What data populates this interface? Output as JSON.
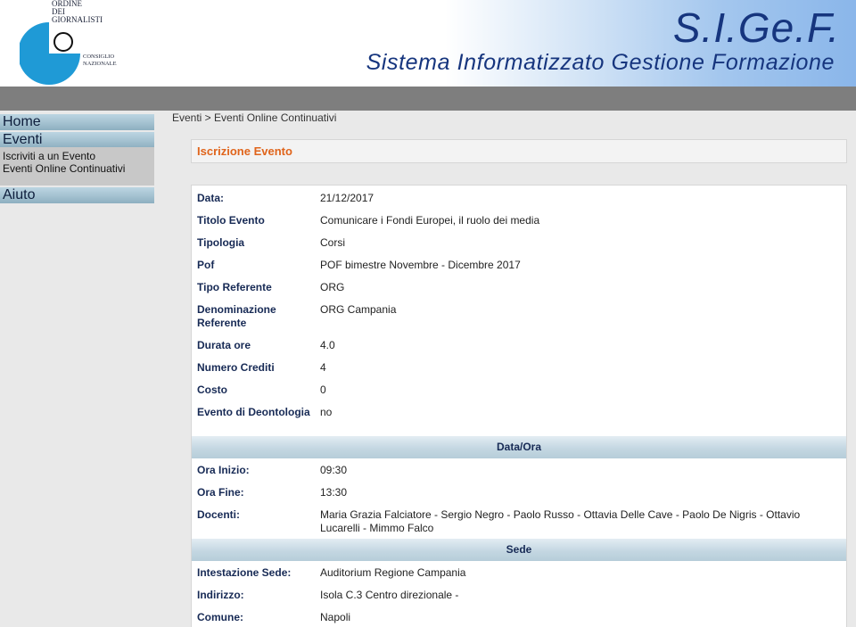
{
  "header": {
    "logo_top_lines": [
      "ORDINE",
      "DEI",
      "GIORNALISTI"
    ],
    "logo_bottom_lines": [
      "CONSIGLIO",
      "NAZIONALE"
    ],
    "title": "S.I.Ge.F.",
    "subtitle": "Sistema Informatizzato Gestione Formazione"
  },
  "sidebar": {
    "home": "Home",
    "eventi": "Eventi",
    "sub_items": [
      "Iscriviti a un Evento",
      "Eventi Online Continuativi"
    ],
    "aiuto": "Aiuto"
  },
  "breadcrumb": "Eventi > Eventi Online Continuativi",
  "box_title": "Iscrizione Evento",
  "rows": [
    {
      "label": "Data:",
      "value": "21/12/2017"
    },
    {
      "label": "Titolo Evento",
      "value": "Comunicare i Fondi Europei, il ruolo dei media"
    },
    {
      "label": "Tipologia",
      "value": "Corsi"
    },
    {
      "label": "Pof",
      "value": "POF bimestre Novembre - Dicembre 2017"
    },
    {
      "label": "Tipo Referente",
      "value": "ORG"
    },
    {
      "label": "Denominazione Referente",
      "value": "ORG Campania"
    },
    {
      "label": "Durata ore",
      "value": "4.0"
    },
    {
      "label": "Numero Crediti",
      "value": "4"
    },
    {
      "label": "Costo",
      "value": "0"
    },
    {
      "label": "Evento di Deontologia",
      "value": "no"
    }
  ],
  "section_dataora": "Data/Ora",
  "rows_dataora": [
    {
      "label": "Ora Inizio:",
      "value": "09:30"
    },
    {
      "label": "Ora Fine:",
      "value": "13:30"
    },
    {
      "label": "Docenti:",
      "value": "Maria Grazia Falciatore - Sergio Negro - Paolo Russo - Ottavia Delle Cave - Paolo De Nigris - Ottavio Lucarelli - Mimmo Falco"
    }
  ],
  "section_sede": "Sede",
  "rows_sede": [
    {
      "label": "Intestazione Sede:",
      "value": "Auditorium Regione Campania"
    },
    {
      "label": "Indirizzo:",
      "value": "Isola C.3 Centro direzionale -"
    },
    {
      "label": "Comune:",
      "value": "Napoli"
    }
  ],
  "colors": {
    "accent": "#e0641b",
    "label": "#172a55",
    "logo_blue": "#1f9ad6",
    "header_text": "#16357e"
  }
}
